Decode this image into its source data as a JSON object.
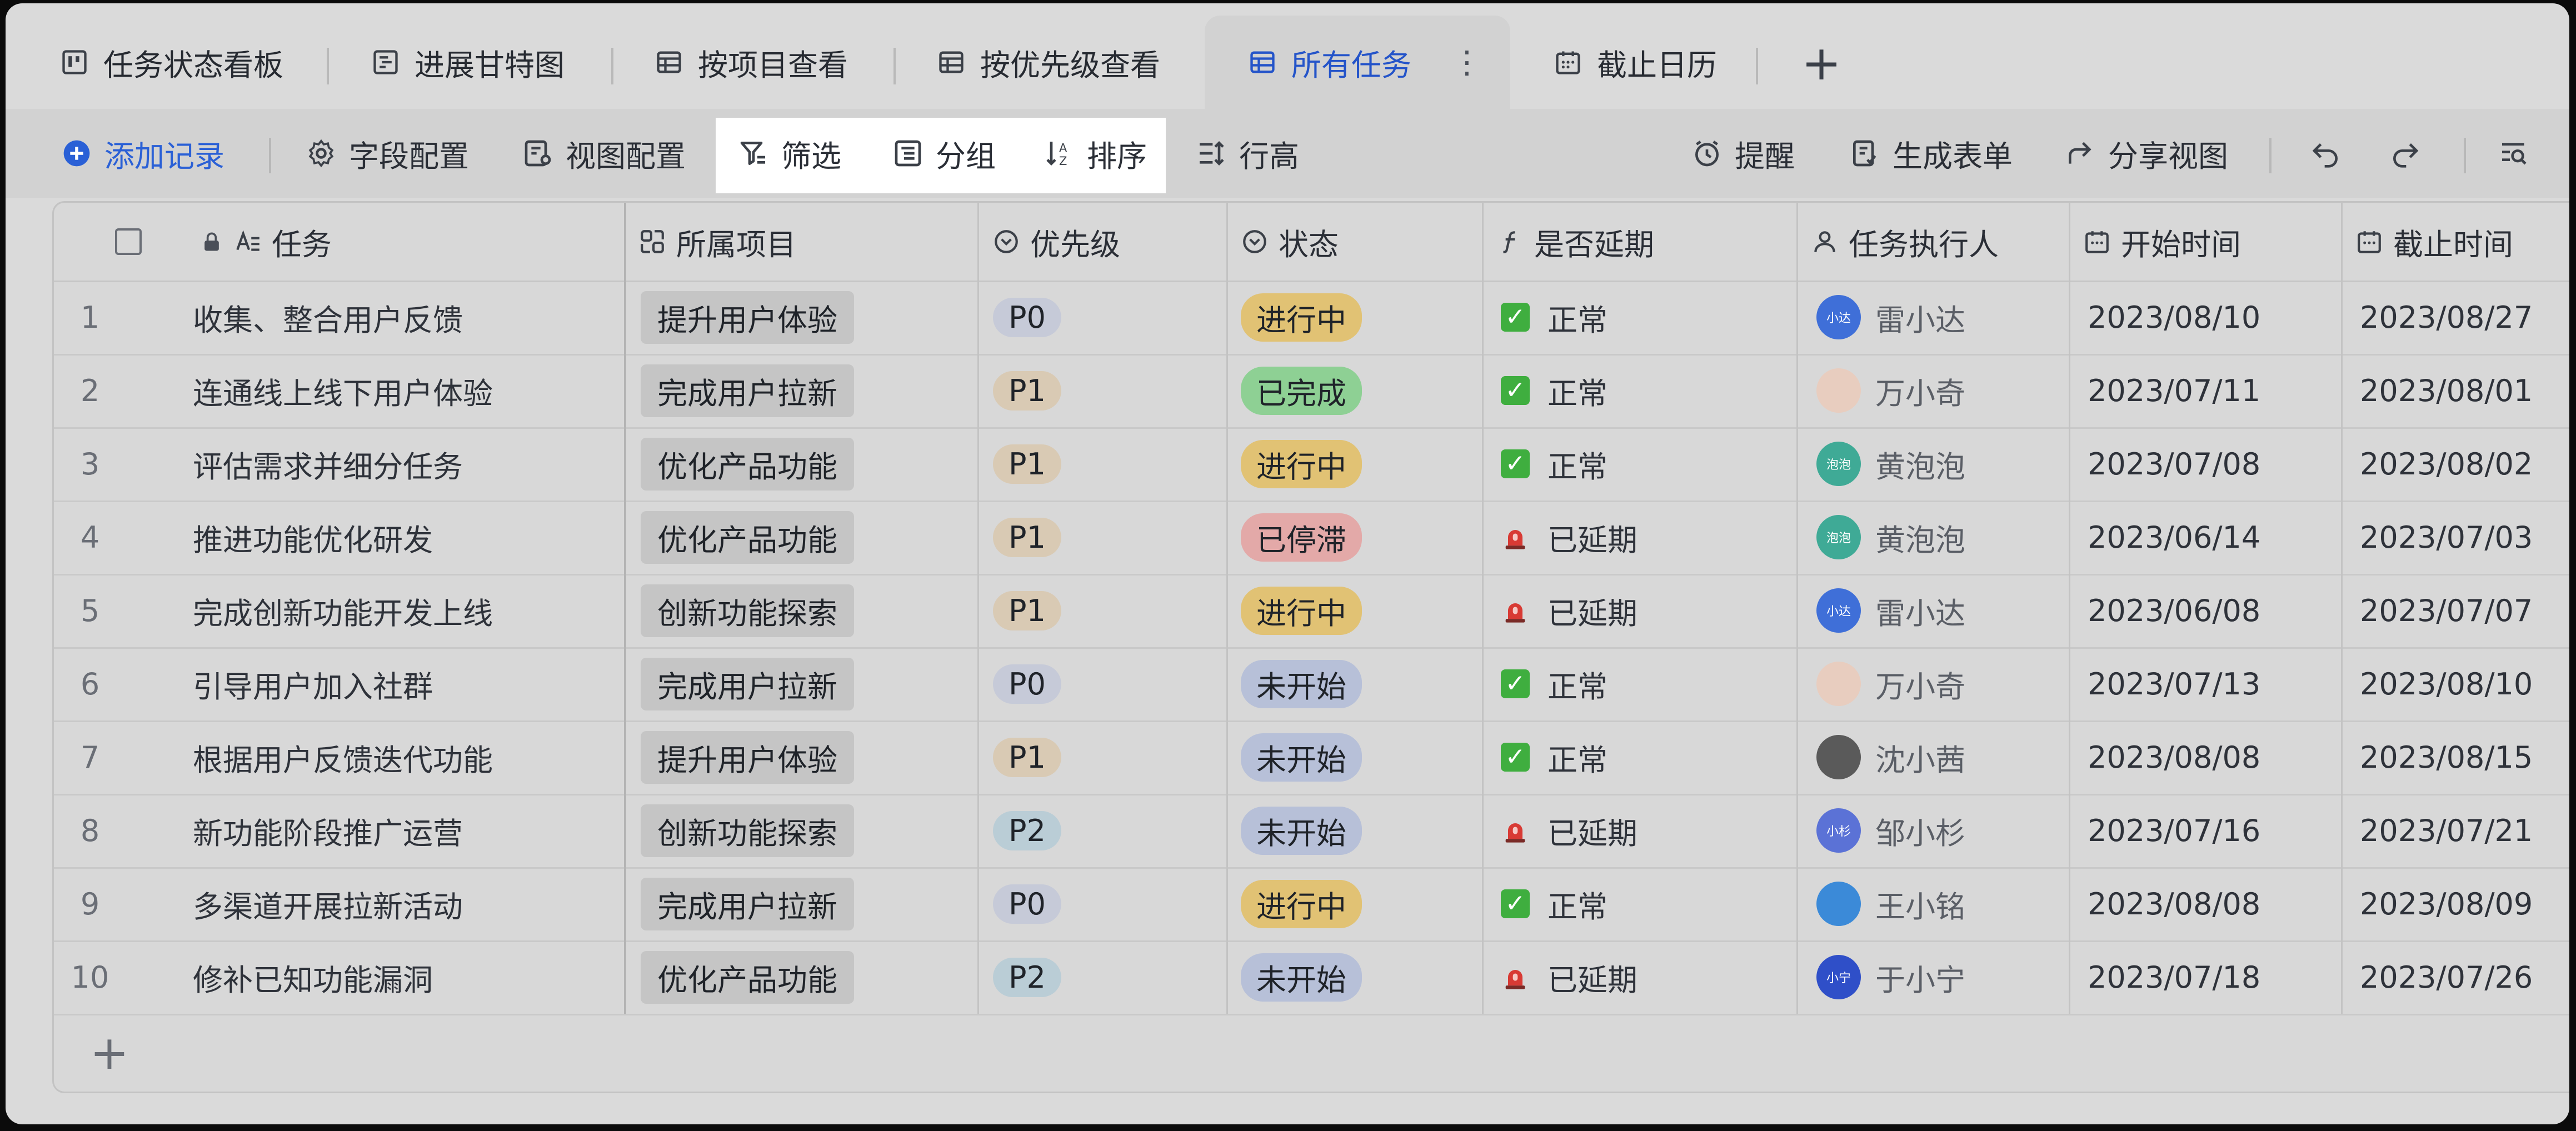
{
  "tabs": [
    {
      "label": "任务状态看板",
      "icon": "kanban-icon"
    },
    {
      "label": "进展甘特图",
      "icon": "gantt-icon"
    },
    {
      "label": "按项目查看",
      "icon": "table-icon"
    },
    {
      "label": "按优先级查看",
      "icon": "table-icon"
    },
    {
      "label": "所有任务",
      "icon": "table-icon",
      "active": true
    },
    {
      "label": "截止日历",
      "icon": "calendar-icon"
    }
  ],
  "tab_more": "⋮",
  "tab_add": "+",
  "toolbar": {
    "add_record": "添加记录",
    "field_config": "字段配置",
    "view_config": "视图配置",
    "filter": "筛选",
    "group": "分组",
    "sort": "排序",
    "row_height": "行高",
    "reminder": "提醒",
    "generate_form": "生成表单",
    "share_view": "分享视图"
  },
  "columns": {
    "task": "任务",
    "project": "所属项目",
    "priority": "优先级",
    "status": "状态",
    "delayed": "是否延期",
    "assignee": "任务执行人",
    "start": "开始时间",
    "due": "截止时间"
  },
  "rows": [
    {
      "n": "1",
      "task": "收集、整合用户反馈",
      "project": "提升用户体验",
      "priority": "P0",
      "status": "进行中",
      "delay": "正常",
      "assignee": "雷小达",
      "avatar": "小达",
      "start": "2023/08/10",
      "due": "2023/08/27"
    },
    {
      "n": "2",
      "task": "连通线上线下用户体验",
      "project": "完成用户拉新",
      "priority": "P1",
      "status": "已完成",
      "delay": "正常",
      "assignee": "万小奇",
      "avatar": "",
      "start": "2023/07/11",
      "due": "2023/08/01"
    },
    {
      "n": "3",
      "task": "评估需求并细分任务",
      "project": "优化产品功能",
      "priority": "P1",
      "status": "进行中",
      "delay": "正常",
      "assignee": "黄泡泡",
      "avatar": "泡泡",
      "start": "2023/07/08",
      "due": "2023/08/02"
    },
    {
      "n": "4",
      "task": "推进功能优化研发",
      "project": "优化产品功能",
      "priority": "P1",
      "status": "已停滞",
      "delay": "已延期",
      "assignee": "黄泡泡",
      "avatar": "泡泡",
      "start": "2023/06/14",
      "due": "2023/07/03"
    },
    {
      "n": "5",
      "task": "完成创新功能开发上线",
      "project": "创新功能探索",
      "priority": "P1",
      "status": "进行中",
      "delay": "已延期",
      "assignee": "雷小达",
      "avatar": "小达",
      "start": "2023/06/08",
      "due": "2023/07/07"
    },
    {
      "n": "6",
      "task": "引导用户加入社群",
      "project": "完成用户拉新",
      "priority": "P0",
      "status": "未开始",
      "delay": "正常",
      "assignee": "万小奇",
      "avatar": "",
      "start": "2023/07/13",
      "due": "2023/08/10"
    },
    {
      "n": "7",
      "task": "根据用户反馈迭代功能",
      "project": "提升用户体验",
      "priority": "P1",
      "status": "未开始",
      "delay": "正常",
      "assignee": "沈小茜",
      "avatar": "",
      "start": "2023/08/08",
      "due": "2023/08/15"
    },
    {
      "n": "8",
      "task": "新功能阶段推广运营",
      "project": "创新功能探索",
      "priority": "P2",
      "status": "未开始",
      "delay": "已延期",
      "assignee": "邹小杉",
      "avatar": "小杉",
      "start": "2023/07/16",
      "due": "2023/07/21"
    },
    {
      "n": "9",
      "task": "多渠道开展拉新活动",
      "project": "完成用户拉新",
      "priority": "P0",
      "status": "进行中",
      "delay": "正常",
      "assignee": "王小铭",
      "avatar": "",
      "start": "2023/08/08",
      "due": "2023/08/09"
    },
    {
      "n": "10",
      "task": "修补已知功能漏洞",
      "project": "优化产品功能",
      "priority": "P2",
      "status": "未开始",
      "delay": "已延期",
      "assignee": "于小宁",
      "avatar": "小宁",
      "start": "2023/07/18",
      "due": "2023/07/26"
    }
  ],
  "add_row": "+",
  "colors": {
    "accent": "#2a60d6",
    "ok": "#3fae3f",
    "late": "#d83a34"
  }
}
